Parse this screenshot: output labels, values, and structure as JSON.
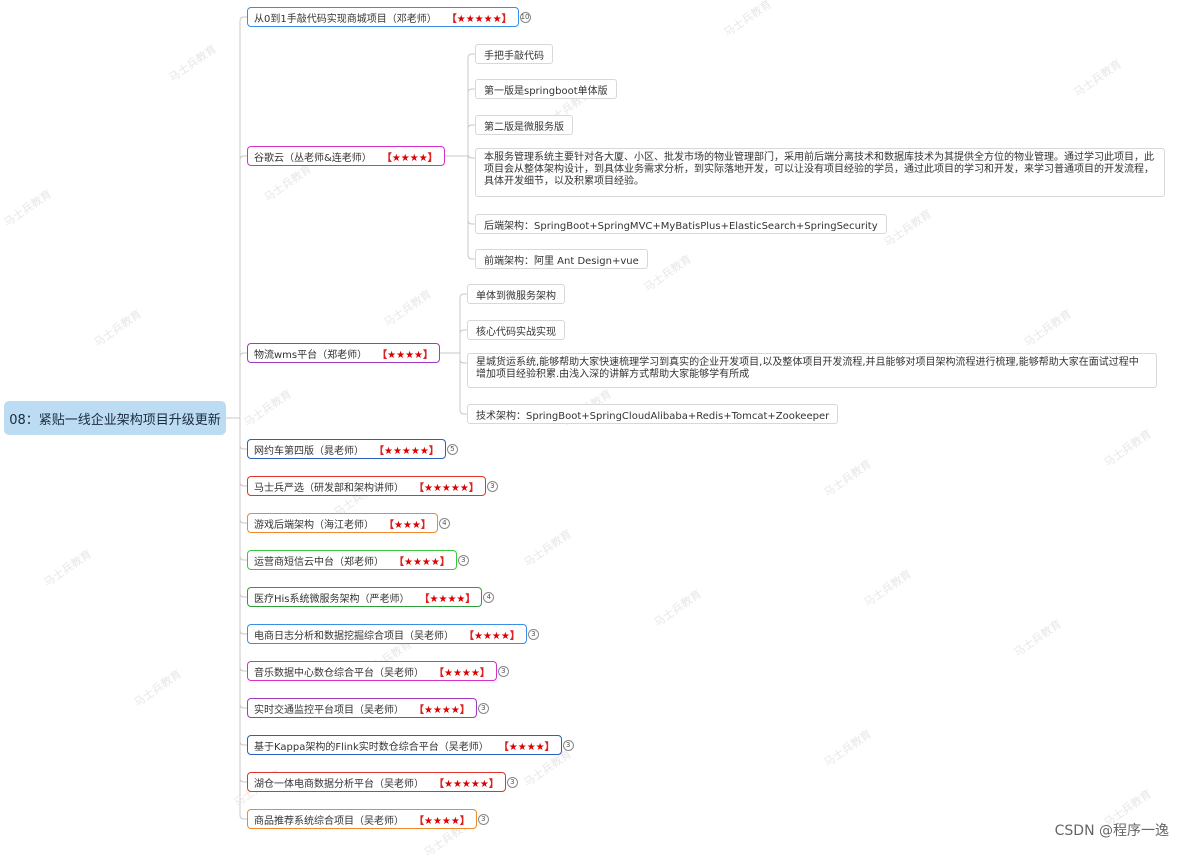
{
  "root": {
    "title": "08：紧贴一线企业架构项目升级更新"
  },
  "stars_open": "【",
  "stars_close": "】",
  "branches": [
    {
      "label": "从0到1手敲代码实现商城项目（邓老师）",
      "stars": "★★★★★",
      "count": "10",
      "color": "#3a8ee6"
    },
    {
      "label": "谷歌云（丛老师&连老师）",
      "stars": "★★★★",
      "count": "",
      "color": "#d630c9",
      "children": [
        "手把手敲代码",
        "第一版是springboot单体版",
        "第二版是微服务版",
        "本服务管理系统主要针对各大厦、小区、批发市场的物业管理部门，采用前后端分离技术和数据库技术为其提供全方位的物业管理。通过学习此项目，此项目会从整体架构设计，到具体业务需求分析，到实际落地开发，可以让没有项目经验的学员，通过此项目的学习和开发，来学习普通项目的开发流程，具体开发细节，以及积累项目经验。",
        "后端架构：SpringBoot+SpringMVC+MyBatisPlus+ElasticSearch+SpringSecurity",
        "前端架构：阿里 Ant Design+vue"
      ]
    },
    {
      "label": "物流wms平台（郑老师）",
      "stars": "★★★★",
      "count": "",
      "color": "#a03ac0",
      "children": [
        "单体到微服务架构",
        "核心代码实战实现",
        "星城货运系统,能够帮助大家快速梳理学习到真实的企业开发项目,以及整体项目开发流程,并且能够对项目架构流程进行梳理,能够帮助大家在面试过程中增加项目经验积累.由浅入深的讲解方式帮助大家能够学有所成",
        "技术架构：SpringBoot+SpringCloudAlibaba+Redis+Tomcat+Zookeeper"
      ]
    },
    {
      "label": "网约车第四版（晁老师）",
      "stars": "★★★★★",
      "count": "5",
      "color": "#2b5fb8"
    },
    {
      "label": "马士兵严选（研发部和架构讲师）",
      "stars": "★★★★★",
      "count": "3",
      "color": "#e0352b"
    },
    {
      "label": "游戏后端架构（海江老师）",
      "stars": "★★★",
      "count": "4",
      "color": "#ee8a2a"
    },
    {
      "label": "运营商短信云中台（郑老师）",
      "stars": "★★★★",
      "count": "3",
      "color": "#39c83c"
    },
    {
      "label": "医疗His系统微服务架构（严老师）",
      "stars": "★★★★",
      "count": "4",
      "color": "#2f9e3a"
    },
    {
      "label": "电商日志分析和数据挖掘综合项目（吴老师）",
      "stars": "★★★★",
      "count": "3",
      "color": "#3a8ee6"
    },
    {
      "label": "音乐数据中心数仓综合平台（吴老师）",
      "stars": "★★★★",
      "count": "3",
      "color": "#d630c9"
    },
    {
      "label": "实时交通监控平台项目（吴老师）",
      "stars": "★★★★",
      "count": "3",
      "color": "#a03ac0"
    },
    {
      "label": "基于Kappa架构的Flink实时数仓综合平台（吴老师）",
      "stars": "★★★★",
      "count": "3",
      "color": "#2b5fb8"
    },
    {
      "label": "湖仓一体电商数据分析平台（吴老师）",
      "stars": "★★★★★",
      "count": "3",
      "color": "#e0352b"
    },
    {
      "label": "商品推荐系统综合项目（吴老师）",
      "stars": "★★★★",
      "count": "3",
      "color": "#ee8a2a"
    }
  ],
  "watermark": "马士兵教育",
  "credit": "CSDN @程序一逸"
}
